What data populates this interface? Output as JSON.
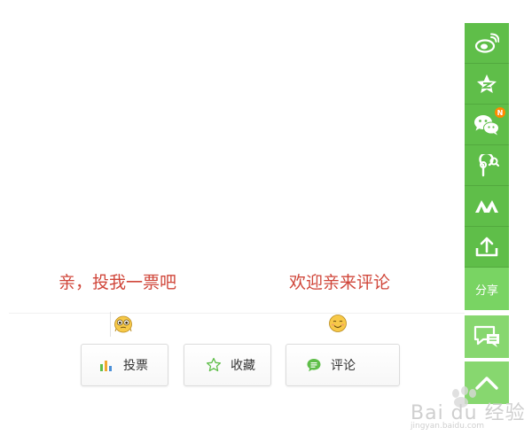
{
  "prompts": {
    "vote_prompt": "亲，投我一票吧",
    "comment_prompt": "欢迎亲来评论"
  },
  "actions": {
    "vote_label": "投票",
    "collect_label": "收藏",
    "comment_label": "评论"
  },
  "sidebar": {
    "items": [
      {
        "icon": "weibo-icon"
      },
      {
        "icon": "qzone-icon"
      },
      {
        "icon": "wechat-icon",
        "badge": "N"
      },
      {
        "icon": "renren-icon"
      },
      {
        "icon": "kaixin-icon"
      },
      {
        "icon": "share-upload-icon"
      }
    ],
    "share_label": "分享",
    "feedback_icon": "feedback-chat-icon",
    "top_icon": "back-to-top-icon"
  },
  "watermark": {
    "brand": "Bai du 经验",
    "sub": "jingyan.baidu.com"
  },
  "colors": {
    "prompt_red": "#d0463a",
    "sidebar_green": "#5fbe49",
    "share_green": "#79d463",
    "light_green": "#87d76f",
    "badge_orange": "#ff8a00"
  }
}
